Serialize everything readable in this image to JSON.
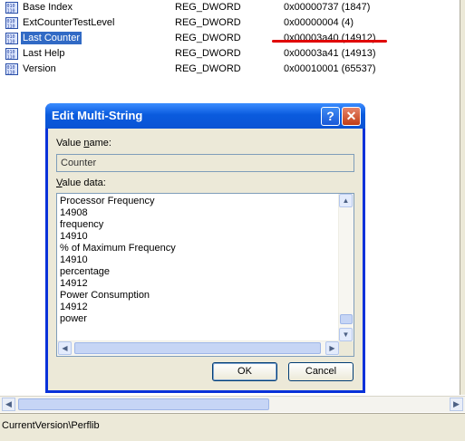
{
  "registry_rows": [
    {
      "name": "Base Index",
      "type": "REG_DWORD",
      "data": "0x00000737 (1847)",
      "selected": false
    },
    {
      "name": "ExtCounterTestLevel",
      "type": "REG_DWORD",
      "data": "0x00000004 (4)",
      "selected": false
    },
    {
      "name": "Last Counter",
      "type": "REG_DWORD",
      "data": "0x00003a40 (14912)",
      "selected": true
    },
    {
      "name": "Last Help",
      "type": "REG_DWORD",
      "data": "0x00003a41 (14913)",
      "selected": false
    },
    {
      "name": "Version",
      "type": "REG_DWORD",
      "data": "0x00010001 (65537)",
      "selected": false
    }
  ],
  "dialog": {
    "title": "Edit Multi-String",
    "help_glyph": "?",
    "close_glyph": "✕",
    "value_name_label_u": "Value ",
    "value_name_label_mn": "n",
    "value_name_label_rest": "ame:",
    "value_name": "Counter",
    "value_data_label_u": "V",
    "value_data_label_rest": "alue data:",
    "value_data_lines": [
      "Processor Frequency",
      "14908",
      "frequency",
      "14910",
      "% of Maximum Frequency",
      "14910",
      "percentage",
      "14912",
      "Power Consumption",
      "14912",
      "power"
    ],
    "ok_label": "OK",
    "cancel_label": "Cancel"
  },
  "status_bar": {
    "path": "CurrentVersion\\Perflib"
  },
  "colors": {
    "selection": "#316ac5",
    "annotation_red": "#e00000",
    "titlebar_blue": "#0a5bde"
  }
}
